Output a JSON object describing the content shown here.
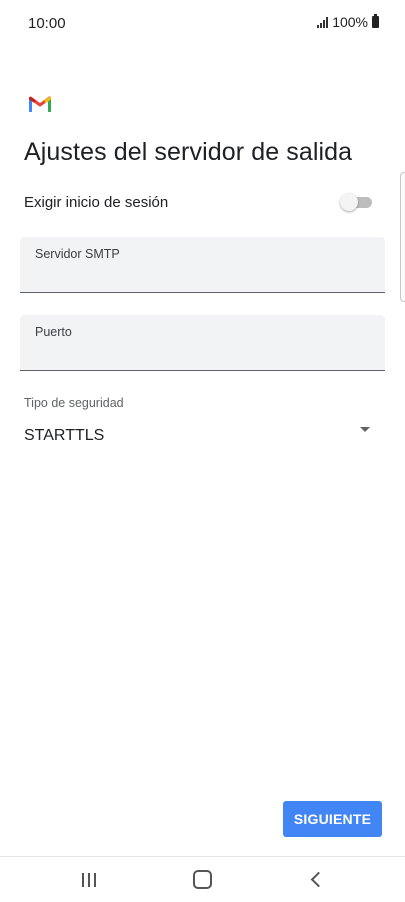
{
  "status_bar": {
    "time": "10:00",
    "battery_text": "100%",
    "icons": [
      "signal-icon",
      "battery-icon"
    ]
  },
  "header": {
    "logo": "gmail-logo",
    "title": "Ajustes del servidor de salida"
  },
  "login_required": {
    "label": "Exigir inicio de sesión",
    "enabled": false
  },
  "smtp_server": {
    "label": "Servidor SMTP",
    "value": ""
  },
  "port": {
    "label": "Puerto",
    "value": ""
  },
  "security": {
    "label": "Tipo de seguridad",
    "selected": "STARTTLS",
    "icon": "dropdown-arrow-icon"
  },
  "next_button_label": "SIGUIENTE",
  "nav_bar": {
    "icons": [
      "recent-apps-icon",
      "home-icon",
      "back-icon"
    ]
  },
  "colors": {
    "accent": "#4285f4",
    "field_background": "#f1f3f4",
    "text": "#202124",
    "gmail_red": "#ea4335",
    "gmail_blue": "#4285f4",
    "gmail_green": "#34a853",
    "gmail_yellow": "#fbbc04"
  }
}
